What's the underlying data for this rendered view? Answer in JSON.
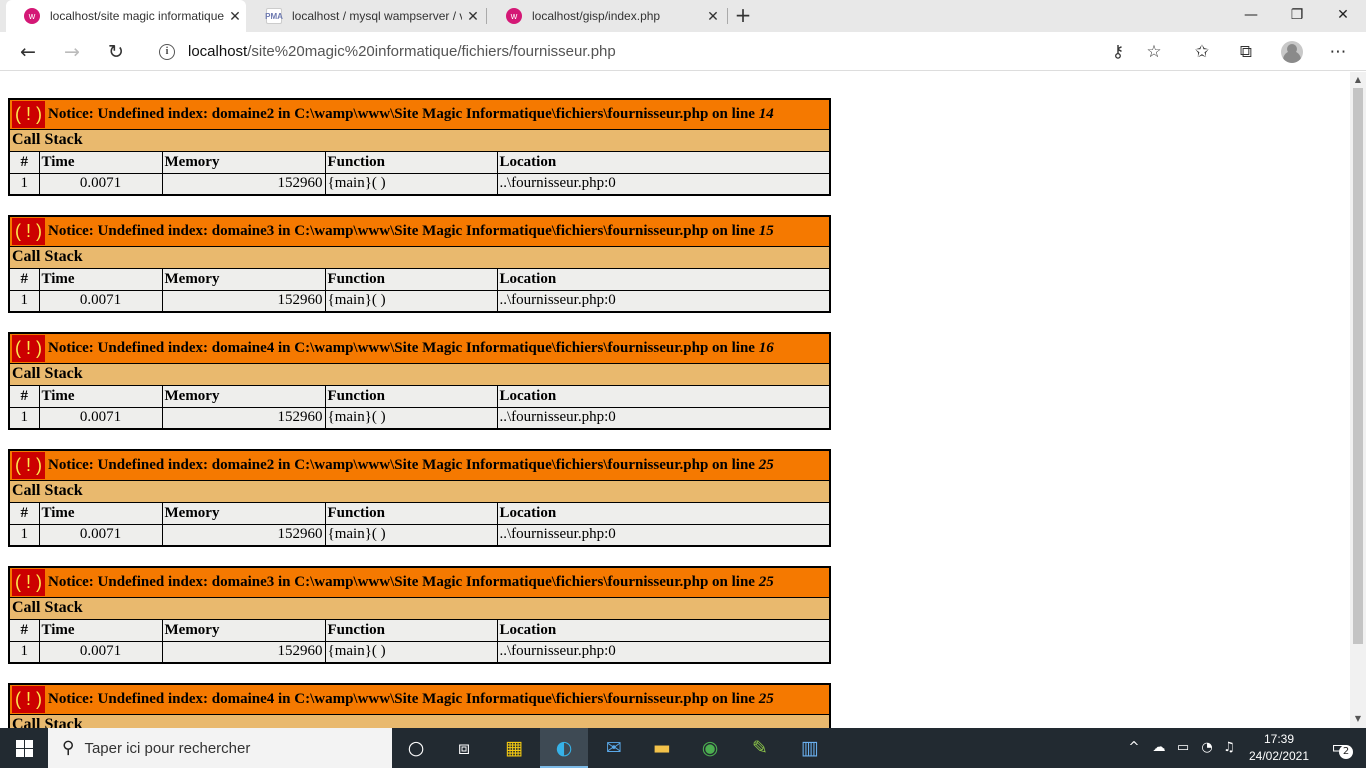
{
  "browser": {
    "tabs": [
      {
        "title": "localhost/site magic informatique",
        "favicon": "wamp-icon",
        "active": true
      },
      {
        "title": "localhost / mysql wampserver / v",
        "favicon": "phpmyadmin-icon",
        "favicon_text": "PMA",
        "active": false
      },
      {
        "title": "localhost/gisp/index.php",
        "favicon": "wamp-icon",
        "active": false
      }
    ],
    "new_tab": "+",
    "url_host": "localhost",
    "url_path": "/site%20magic%20informatique/fichiers/fournisseur.php"
  },
  "errors": [
    {
      "message": "Notice: Undefined index: domaine2 in C:\\wamp\\www\\Site Magic Informatique\\fichiers\\fournisseur.php on line",
      "line": "14"
    },
    {
      "message": "Notice: Undefined index: domaine3 in C:\\wamp\\www\\Site Magic Informatique\\fichiers\\fournisseur.php on line",
      "line": "15"
    },
    {
      "message": "Notice: Undefined index: domaine4 in C:\\wamp\\www\\Site Magic Informatique\\fichiers\\fournisseur.php on line",
      "line": "16"
    },
    {
      "message": "Notice: Undefined index: domaine2 in C:\\wamp\\www\\Site Magic Informatique\\fichiers\\fournisseur.php on line",
      "line": "25"
    },
    {
      "message": "Notice: Undefined index: domaine3 in C:\\wamp\\www\\Site Magic Informatique\\fichiers\\fournisseur.php on line",
      "line": "25"
    },
    {
      "message": "Notice: Undefined index: domaine4 in C:\\wamp\\www\\Site Magic Informatique\\fichiers\\fournisseur.php on line",
      "line": "25"
    }
  ],
  "error_badge": "( ! )",
  "call_stack_label": "Call Stack",
  "columns": [
    "#",
    "Time",
    "Memory",
    "Function",
    "Location"
  ],
  "stack_row": {
    "index": "1",
    "time": "0.0071",
    "memory": "152960",
    "function": "{main}( )",
    "location": "..\\fournisseur.php:0"
  },
  "taskbar": {
    "search_placeholder": "Taper ici pour rechercher",
    "time": "17:39",
    "date": "24/02/2021",
    "notification_count": "2"
  }
}
